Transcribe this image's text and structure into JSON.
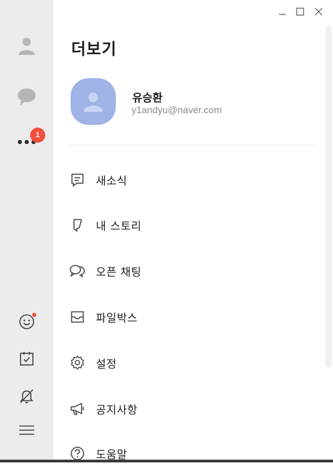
{
  "window": {
    "controls": {
      "minimize": "minimize-icon",
      "maximize": "maximize-icon",
      "close": "close-icon"
    }
  },
  "sidebar": {
    "items": [
      {
        "name": "friends",
        "icon": "person-icon"
      },
      {
        "name": "chats",
        "icon": "chat-bubble-icon"
      },
      {
        "name": "more",
        "icon": "more-dots-icon",
        "badge": "1"
      }
    ],
    "bottom_items": [
      {
        "name": "emoticon",
        "icon": "smiley-icon",
        "has_dot": true
      },
      {
        "name": "calendar",
        "icon": "calendar-icon"
      },
      {
        "name": "notifications",
        "icon": "bell-off-icon"
      },
      {
        "name": "menu",
        "icon": "hamburger-icon"
      }
    ]
  },
  "page": {
    "title": "더보기"
  },
  "profile": {
    "name": "유승환",
    "email": "y1andyu@naver.com"
  },
  "menu": [
    {
      "label": "새소식",
      "icon": "news-icon"
    },
    {
      "label": "내 스토리",
      "icon": "story-icon"
    },
    {
      "label": "오픈 채팅",
      "icon": "open-chat-icon"
    },
    {
      "label": "파일박스",
      "icon": "file-box-icon"
    },
    {
      "label": "설정",
      "icon": "gear-icon"
    },
    {
      "label": "공지사항",
      "icon": "megaphone-icon"
    },
    {
      "label": "도움말",
      "icon": "help-icon"
    }
  ],
  "colors": {
    "sidebar_bg": "#ececec",
    "badge": "#f24e3c",
    "avatar_bg": "#9fb3e6",
    "icon": "#555555"
  }
}
